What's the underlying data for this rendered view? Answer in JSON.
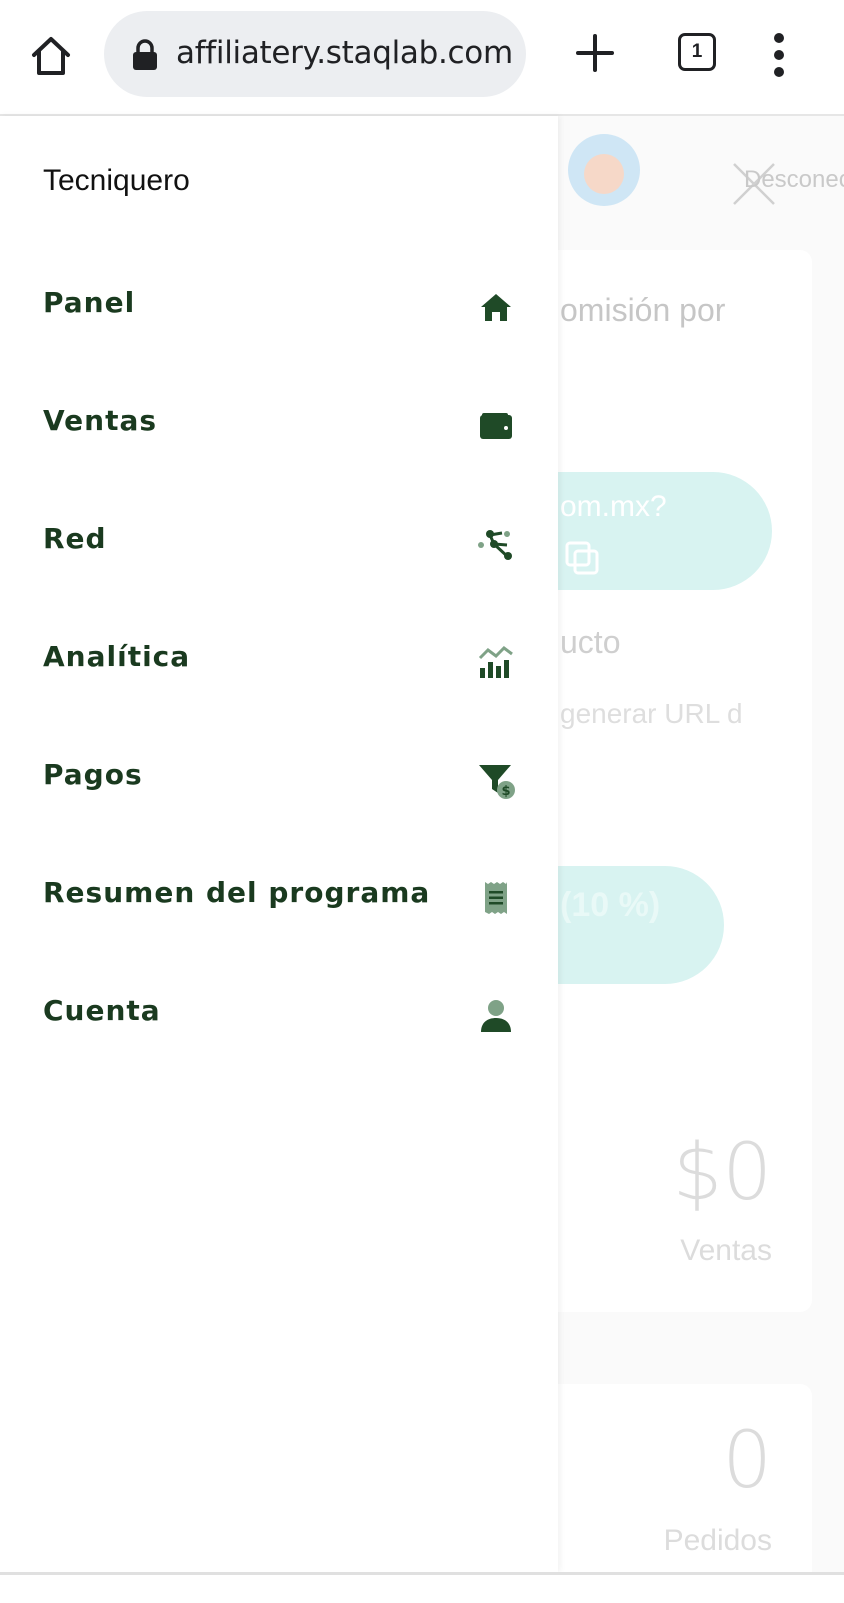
{
  "browser": {
    "url_text": "affiliatery.staqlab.com",
    "tab_count": "1",
    "icons": {
      "home": "home-icon",
      "lock": "lock-icon",
      "new_tab": "plus-icon",
      "tabs": "tab-switcher-icon",
      "menu": "more-vert-icon"
    }
  },
  "drawer": {
    "brand": "Tecniquero",
    "items": [
      {
        "label": "Panel",
        "icon": "home-icon"
      },
      {
        "label": "Ventas",
        "icon": "wallet-icon"
      },
      {
        "label": "Red",
        "icon": "network-icon"
      },
      {
        "label": "Analítica",
        "icon": "analytics-icon"
      },
      {
        "label": "Pagos",
        "icon": "payout-filter-icon"
      },
      {
        "label": "Resumen del programa",
        "icon": "receipt-icon"
      },
      {
        "label": "Cuenta",
        "icon": "user-icon"
      }
    ]
  },
  "background_page": {
    "logout_label": "Desconectar",
    "comision_text": "omisión por",
    "link_text": "om.mx?",
    "producto_text": "ucto",
    "generar_placeholder": "generar URL d",
    "percent_text": "(10 %)",
    "sales_amount": "$0",
    "sales_label": "Ventas",
    "orders_count": "0",
    "orders_label": "Pedidos"
  },
  "colors": {
    "drawer_text": "#1a3a1f",
    "icon_dark": "#1f4a27",
    "accent_pill": "#d8f3f1"
  }
}
